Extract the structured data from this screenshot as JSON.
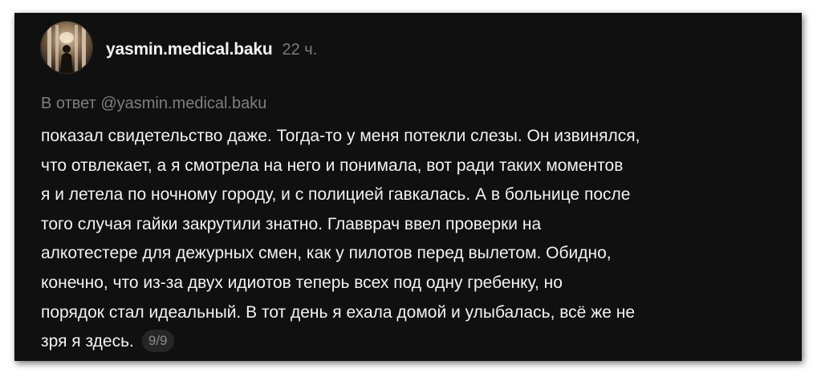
{
  "post": {
    "username": "yasmin.medical.baku",
    "time": "22 ч.",
    "reply_prefix": "В ответ",
    "reply_mention": "@yasmin.medical.baku",
    "lines": [
      "показал свидетельство даже. Тогда-то у меня потекли слезы. Он извинялся,",
      "что отвлекает, а я смотрела на него и понимала, вот ради таких моментов",
      "я и летела по ночному городу, и с полицией гавкалась. А в больнице после",
      "того случая гайки закрутили знатно. Главврач ввел проверки на",
      "алкотестере для дежурных смен, как у пилотов перед вылетом. Обидно,",
      "конечно, что из-за двух идиотов теперь всех под одну гребенку, но",
      "порядок стал идеальный. В тот день я ехала домой и улыбалась, всё же не",
      "зря я здесь."
    ],
    "page_counter": "9/9"
  },
  "colors": {
    "background": "#101010",
    "text": "#f2f2f2",
    "muted": "#7a7a7a"
  }
}
